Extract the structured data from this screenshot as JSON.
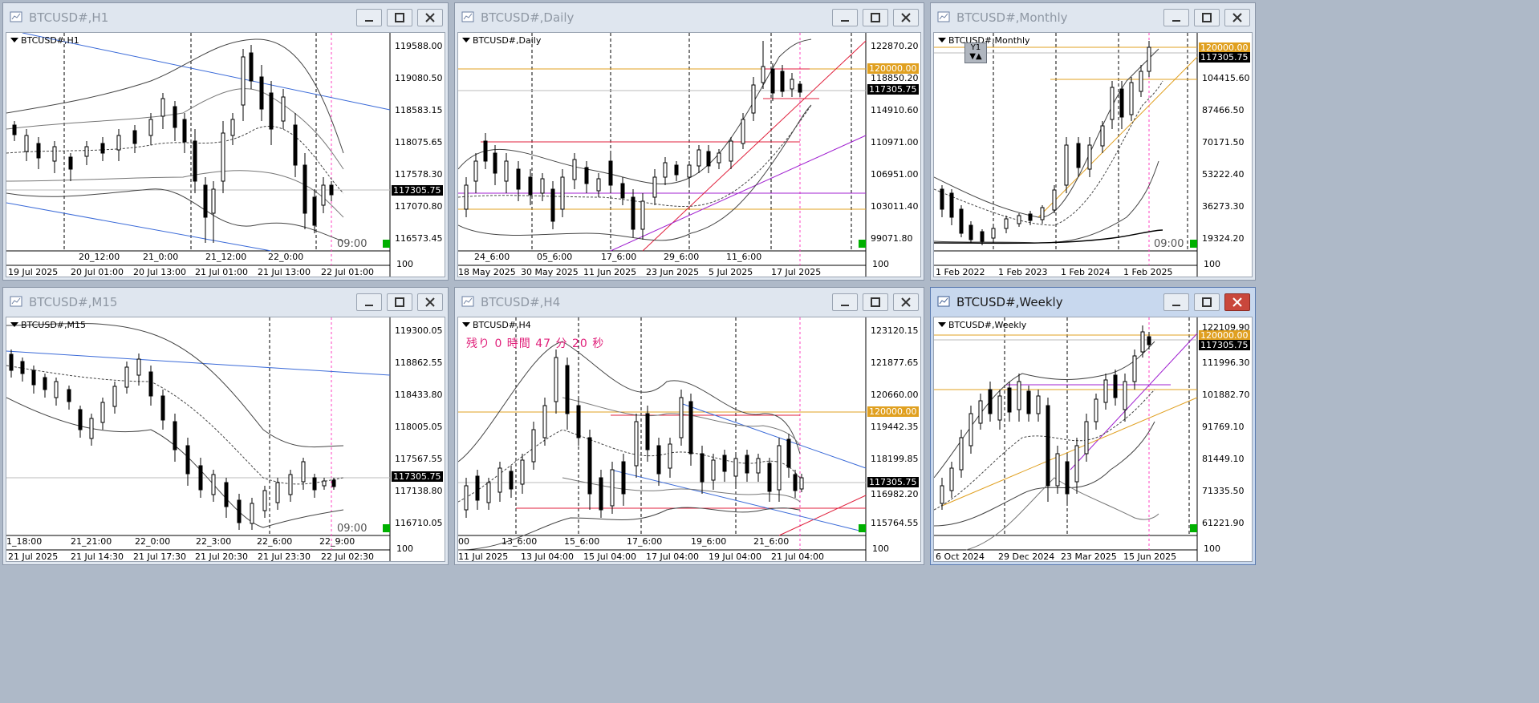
{
  "windows": {
    "h1": {
      "title": "BTCUSD#,H1",
      "symbol": "BTCUSD#,H1",
      "price_labels": [
        "119588.00",
        "119080.50",
        "118583.15",
        "118075.65",
        "117578.30",
        "117070.80",
        "116573.45"
      ],
      "current_price": "117305.75",
      "top_times": [
        "20_12:00",
        "21_0:00",
        "21_12:00",
        "22_0:00"
      ],
      "bottom_times": [
        "19 Jul 2025",
        "20 Jul 01:00",
        "20 Jul 13:00",
        "21 Jul 01:00",
        "21 Jul 13:00",
        "22 Jul 01:00"
      ],
      "clock": "09:00",
      "bottom_right": "100"
    },
    "daily": {
      "title": "BTCUSD#,Daily",
      "symbol": "BTCUSD#,Daily",
      "price_labels": [
        "122870.20",
        "118850.20",
        "114910.60",
        "110971.00",
        "106951.00",
        "103011.40",
        "99071.80"
      ],
      "level_label": "120000.00",
      "current_price": "117305.75",
      "top_times": [
        "24_6:00",
        "05_6:00",
        "17_6:00",
        "29_6:00",
        "11_6:00"
      ],
      "bottom_times": [
        "18 May 2025",
        "30 May 2025",
        "11 Jun 2025",
        "23 Jun 2025",
        "5 Jul 2025",
        "17 Jul 2025"
      ],
      "bottom_right": "100"
    },
    "monthly": {
      "title": "BTCUSD#,Monthly",
      "symbol": "BTCUSD#,Monthly",
      "price_labels": [
        "104415.60",
        "87466.50",
        "70171.50",
        "53222.40",
        "36273.30",
        "19324.20"
      ],
      "level_label": "120000.00",
      "current_price": "117305.75",
      "bottom_times": [
        "1 Feb 2022",
        "1 Feb 2023",
        "1 Feb 2024",
        "1 Feb 2025"
      ],
      "period_button": "Y1",
      "clock": "09:00",
      "bottom_right": "100"
    },
    "m15": {
      "title": "BTCUSD#,M15",
      "symbol": "BTCUSD#,M15",
      "price_labels": [
        "119300.05",
        "118862.55",
        "118433.80",
        "118005.05",
        "117567.55",
        "117138.80",
        "116710.05"
      ],
      "current_price": "117305.75",
      "top_times": [
        "1_18:00",
        "21_21:00",
        "22_0:00",
        "22_3:00",
        "22_6:00",
        "22_9:00"
      ],
      "bottom_times": [
        "21 Jul 2025",
        "21 Jul 14:30",
        "21 Jul 17:30",
        "21 Jul 20:30",
        "21 Jul 23:30",
        "22 Jul 02:30"
      ],
      "clock": "09:00",
      "bottom_right": "100"
    },
    "h4": {
      "title": "BTCUSD#,H4",
      "symbol": "BTCUSD#,H4",
      "countdown": "残り 0 時間 47 分 20 秒",
      "price_labels": [
        "123120.15",
        "121877.65",
        "120660.00",
        "119442.35",
        "118199.85",
        "116982.20",
        "115764.55"
      ],
      "level_label": "120000.00",
      "current_price": "117305.75",
      "top_times": [
        "00",
        "13_6:00",
        "15_6:00",
        "17_6:00",
        "19_6:00",
        "21_6:00"
      ],
      "bottom_times": [
        "11 Jul 2025",
        "13 Jul 04:00",
        "15 Jul 04:00",
        "17 Jul 04:00",
        "19 Jul 04:00",
        "21 Jul 04:00"
      ],
      "bottom_right": "100"
    },
    "weekly": {
      "title": "BTCUSD#,Weekly",
      "symbol": "BTCUSD#,Weekly",
      "price_labels": [
        "122109.90",
        "111996.30",
        "101882.70",
        "91769.10",
        "81449.10",
        "71335.50",
        "61221.90"
      ],
      "level_label": "120000.00",
      "current_price": "117305.75",
      "bottom_times": [
        "6 Oct 2024",
        "29 Dec 2024",
        "23 Mar 2025",
        "15 Jun 2025"
      ],
      "bottom_right": "100"
    }
  },
  "colors": {
    "level_line": "#e0a020",
    "red_line": "#e0203c",
    "blue_line": "#3a6ad8",
    "magenta_line": "#a020d0",
    "period_sep": "#ff40c0",
    "accent_green": "#00b000"
  }
}
